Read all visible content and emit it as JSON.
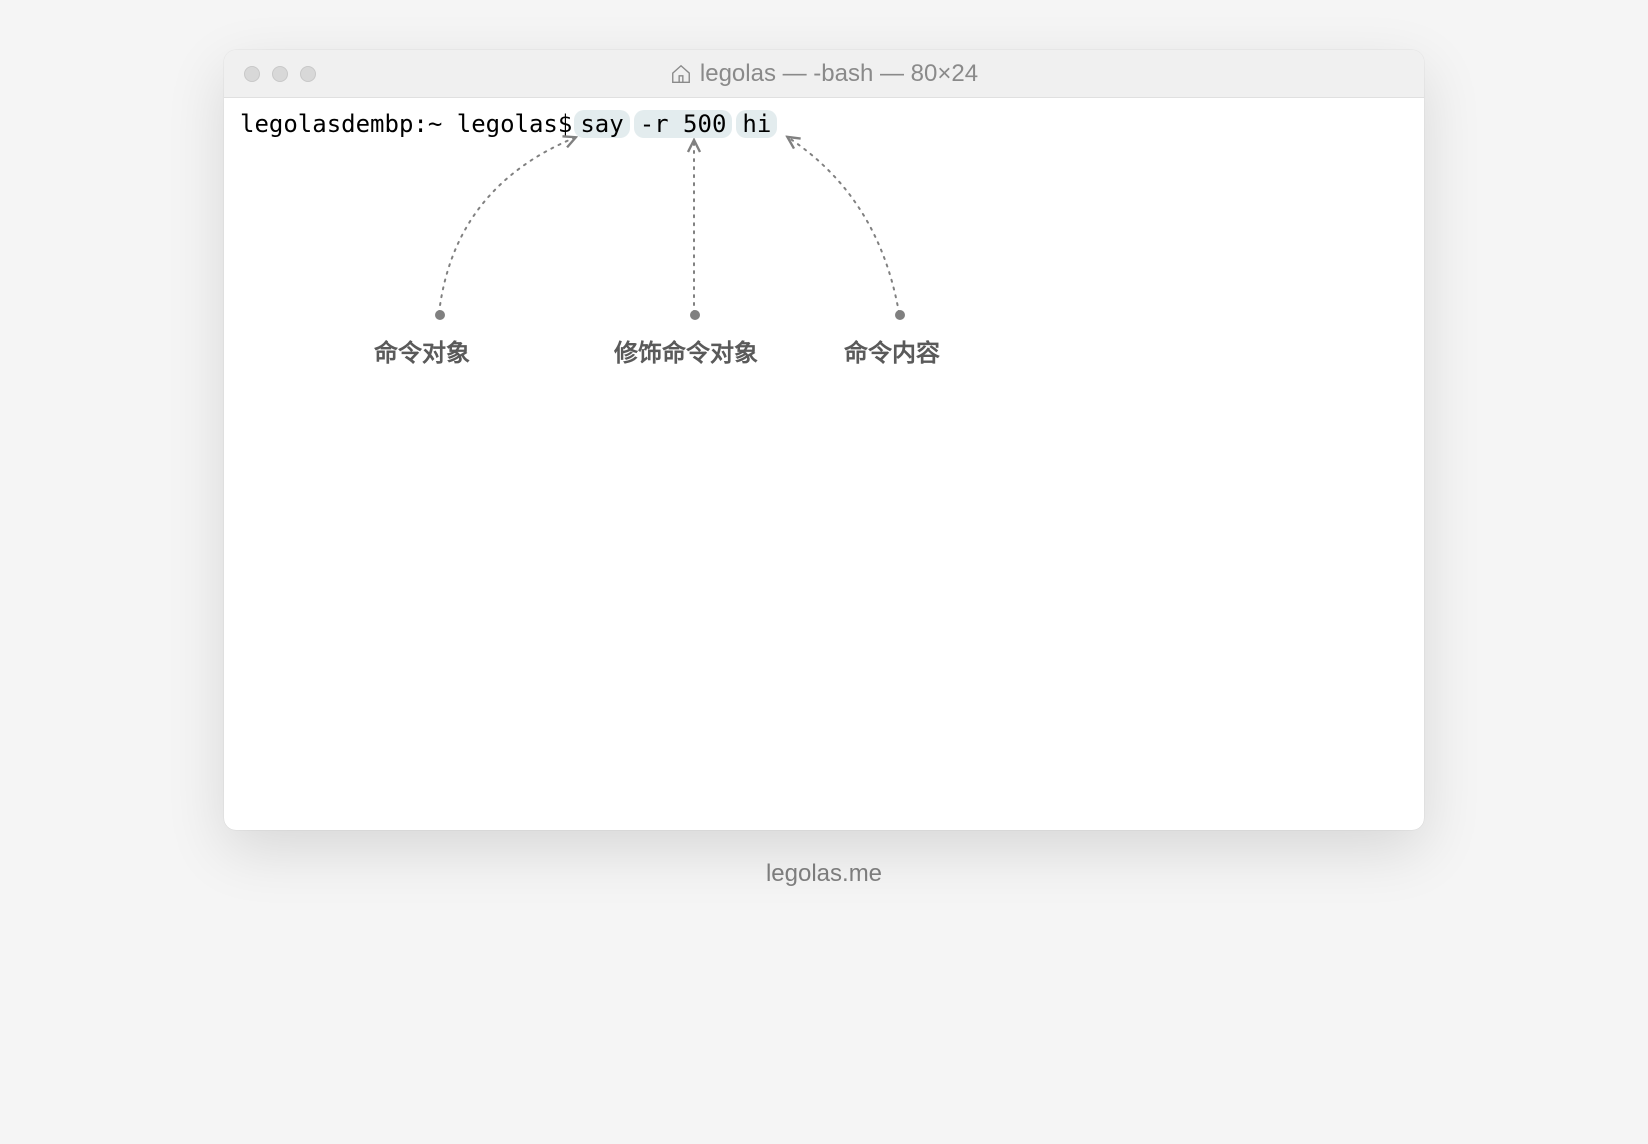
{
  "window": {
    "title": "legolas — -bash — 80×24"
  },
  "terminal": {
    "prompt": "legolasdembp:~ legolas$ ",
    "command_parts": {
      "command": "say",
      "options": "-r 500",
      "argument": "hi"
    }
  },
  "annotations": {
    "command_object": "命令对象",
    "modifier": "修饰命令对象",
    "content": "命令内容"
  },
  "footer": {
    "text": "legolas.me"
  }
}
